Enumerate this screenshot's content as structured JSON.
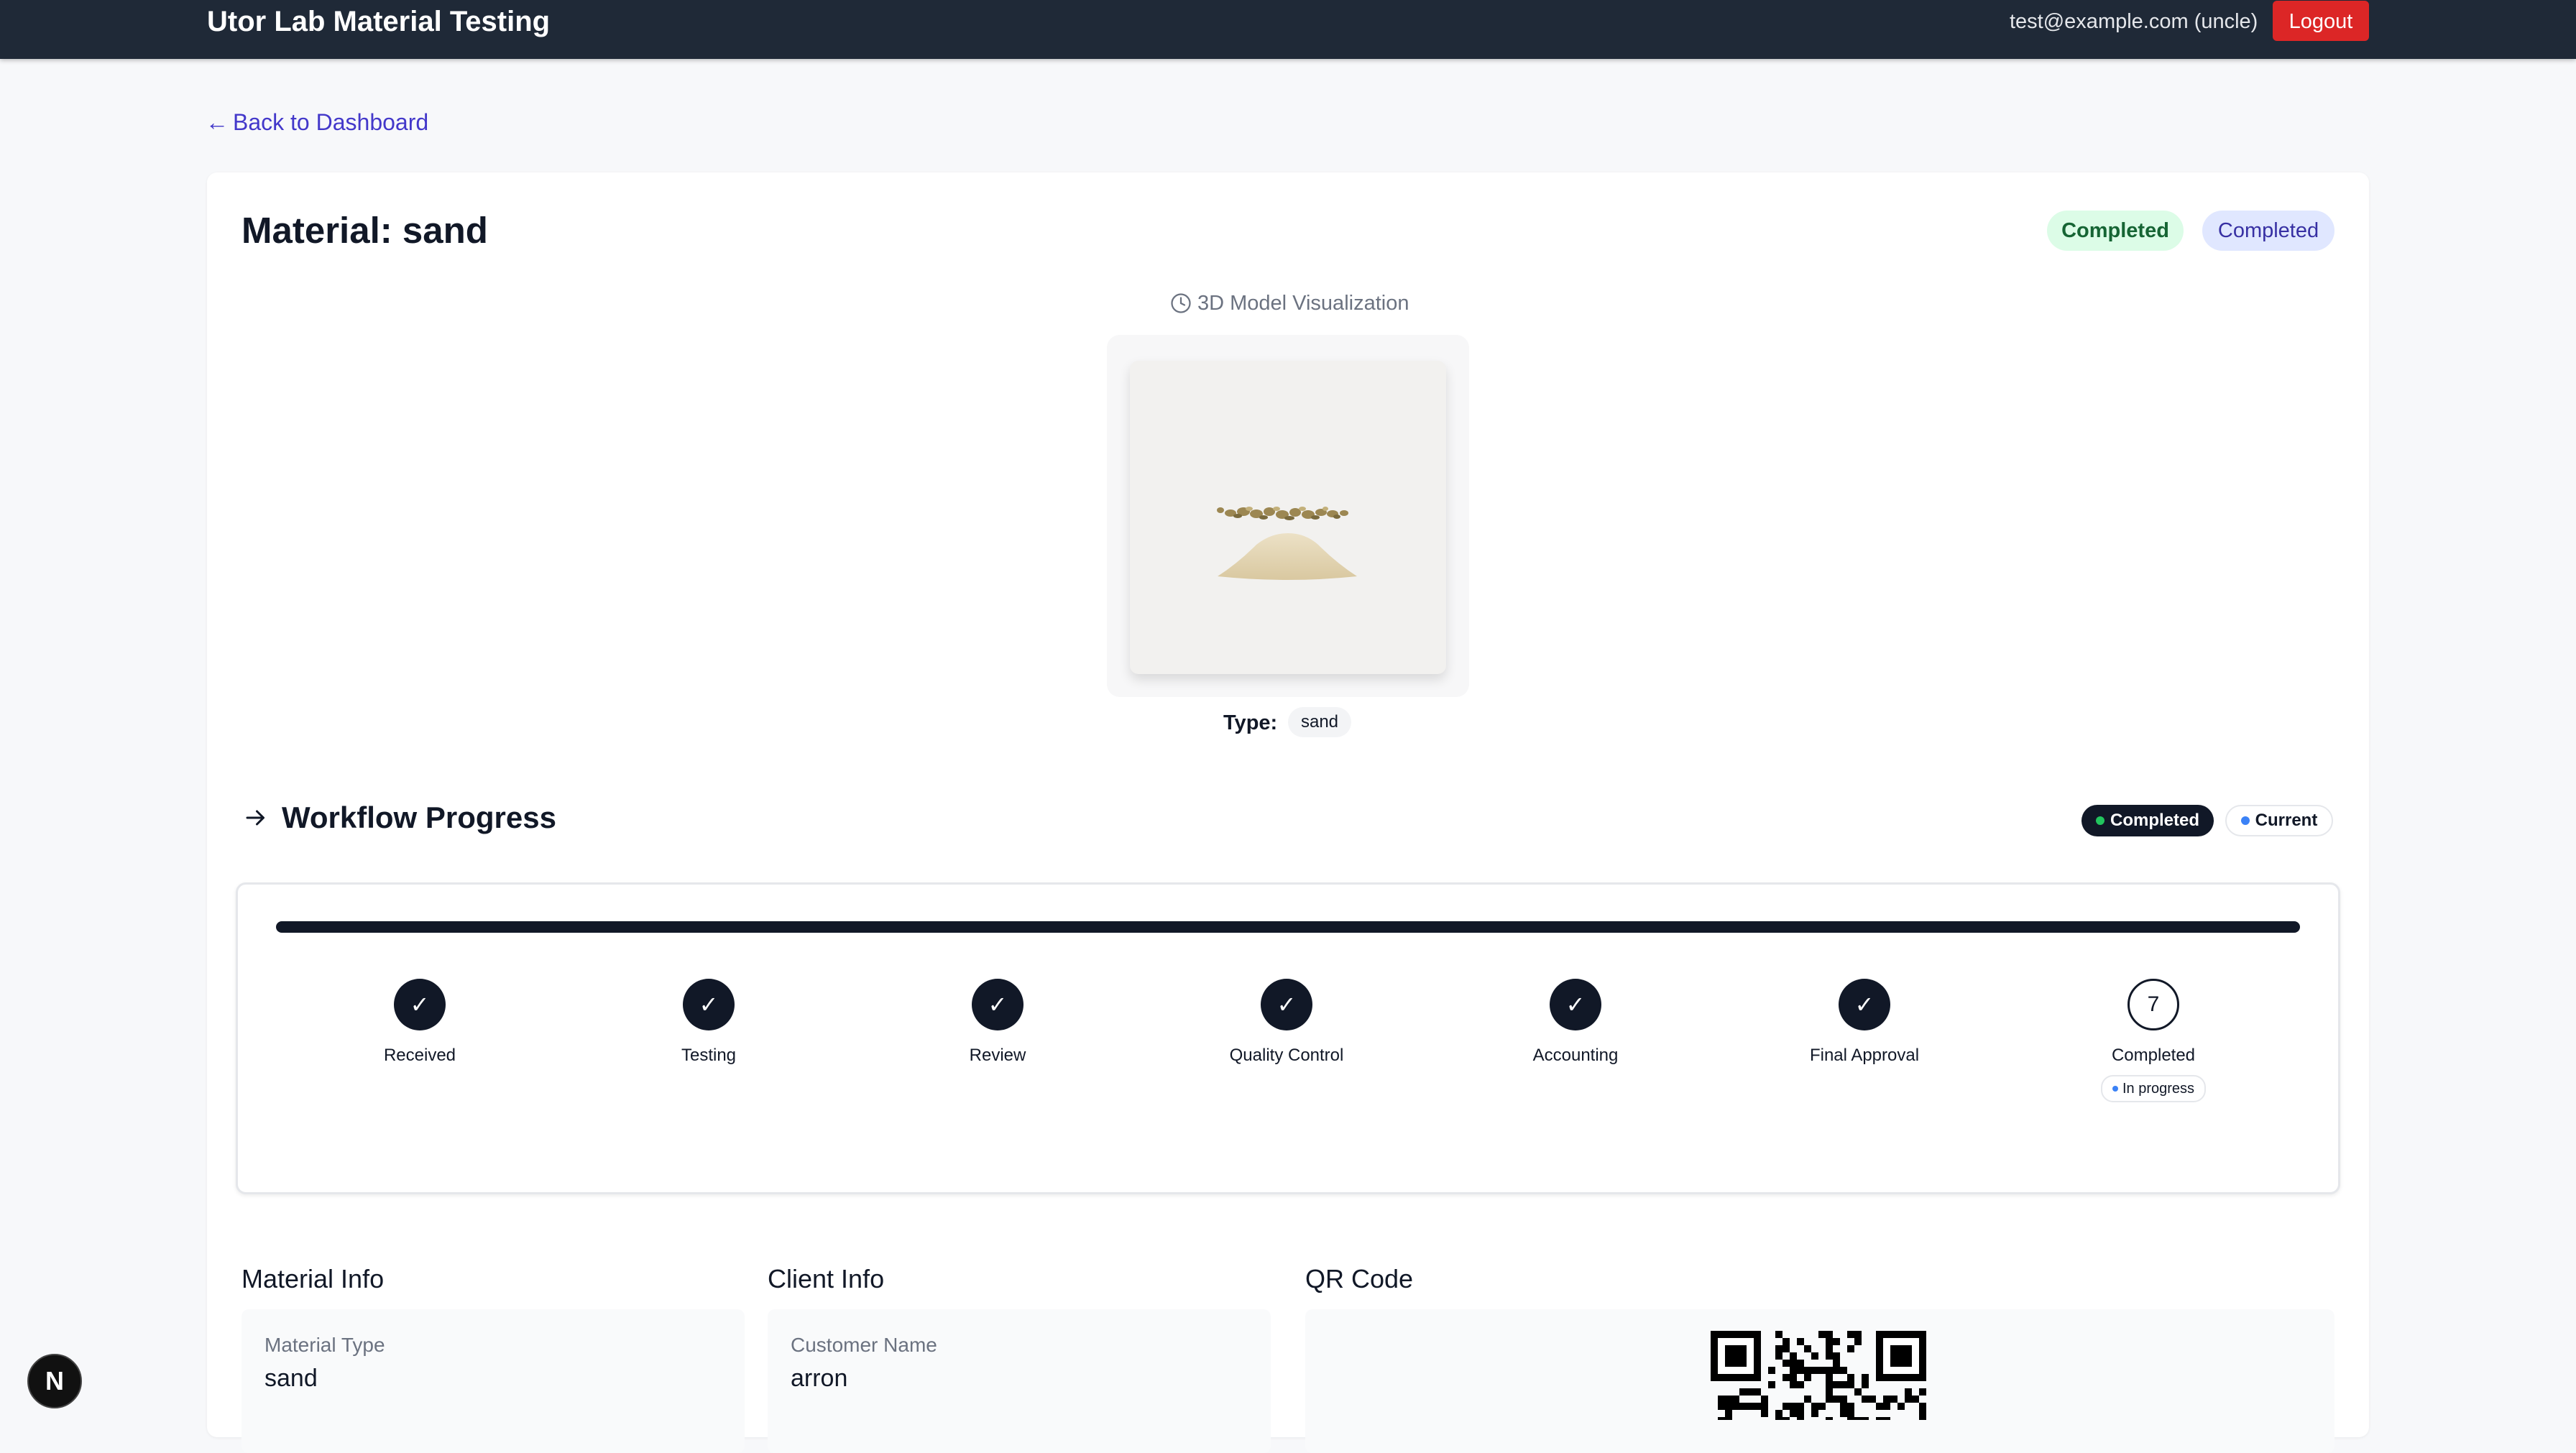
{
  "header": {
    "app_title": "Utor Lab Material Testing",
    "user_email": "test@example.com (uncle)",
    "logout_label": "Logout"
  },
  "nav": {
    "back_arrow": "←",
    "back_label": "Back to Dashboard"
  },
  "material": {
    "title": "Material: sand",
    "status_badge_1": "Completed",
    "status_badge_2": "Completed",
    "viz_label": "3D Model Visualization",
    "type_label": "Type:",
    "type_value": "sand"
  },
  "workflow": {
    "title": "Workflow Progress",
    "legend_completed": "Completed",
    "legend_current": "Current",
    "progress_fraction": 1.0,
    "steps": [
      {
        "label": "Received",
        "state": "done",
        "icon": "✓"
      },
      {
        "label": "Testing",
        "state": "done",
        "icon": "✓"
      },
      {
        "label": "Review",
        "state": "done",
        "icon": "✓"
      },
      {
        "label": "Quality Control",
        "state": "done",
        "icon": "✓"
      },
      {
        "label": "Accounting",
        "state": "done",
        "icon": "✓"
      },
      {
        "label": "Final Approval",
        "state": "done",
        "icon": "✓"
      },
      {
        "label": "Completed",
        "state": "current",
        "icon": "7",
        "badge": "In progress"
      }
    ]
  },
  "sections": {
    "material_info": {
      "title": "Material Info",
      "fields": [
        {
          "label": "Material Type",
          "value": "sand"
        }
      ]
    },
    "client_info": {
      "title": "Client Info",
      "fields": [
        {
          "label": "Customer Name",
          "value": "arron"
        }
      ]
    },
    "qr": {
      "title": "QR Code"
    }
  },
  "dev_badge": {
    "letter": "N"
  },
  "colors": {
    "header_bg": "#1f2937",
    "logout_bg": "#dc2626",
    "link": "#4338ca",
    "completed_green_bg": "#dcfce7",
    "completed_indigo_bg": "#e0e7ff",
    "legend_completed_dot": "#22c55e",
    "legend_current_dot": "#3b82f6"
  },
  "icons": {
    "clock": "clock-icon",
    "arrow_right": "arrow-right-icon",
    "check": "check-icon"
  }
}
